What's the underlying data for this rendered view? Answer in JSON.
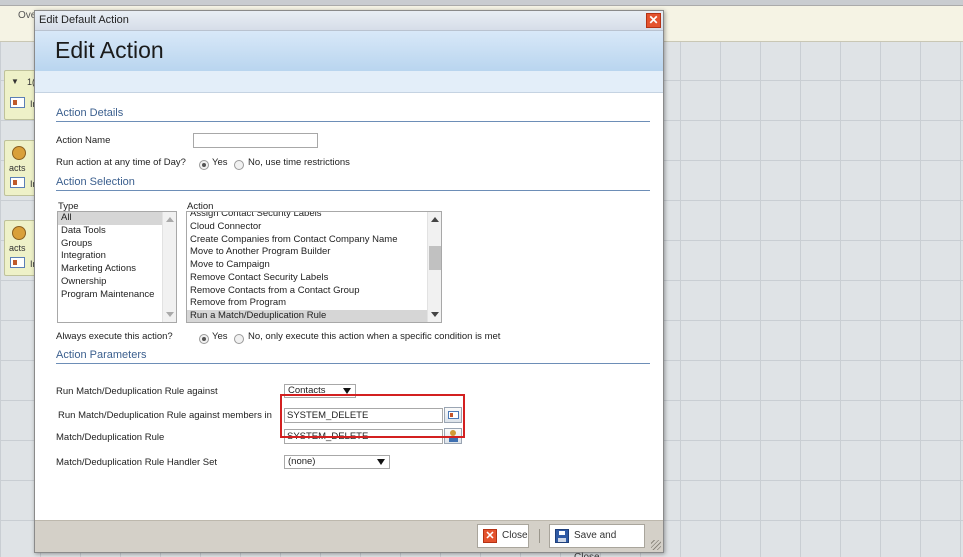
{
  "background": {
    "overview_label": "Ove",
    "node_labels": [
      "1(",
      "Ir",
      "acts",
      "Ir",
      "acts",
      "Ir"
    ]
  },
  "dialog": {
    "window_title": "Edit Default Action",
    "close_glyph": "✕",
    "header_title": "Edit Action"
  },
  "action_details": {
    "heading": "Action Details",
    "name_label": "Action Name",
    "name_value": "",
    "time_label": "Run action at any time of Day?",
    "time_options": [
      {
        "label": "Yes",
        "selected": true
      },
      {
        "label": "No, use time restrictions",
        "selected": false
      }
    ]
  },
  "action_selection": {
    "heading": "Action Selection",
    "type_header": "Type",
    "action_header": "Action",
    "types": [
      "All",
      "Data Tools",
      "Groups",
      "Integration",
      "Marketing Actions",
      "Ownership",
      "Program Maintenance"
    ],
    "selected_type": "All",
    "actions": [
      "Assign Contact Security Labels",
      "Cloud Connector",
      "Create Companies from Contact Company Name",
      "Move to Another Program Builder",
      "Move to Campaign",
      "Remove Contact Security Labels",
      "Remove Contacts from a Contact Group",
      "Remove from Program",
      "Run a Match/Deduplication Rule"
    ],
    "selected_action": "Run a Match/Deduplication Rule",
    "always_label": "Always execute this action?",
    "always_options": [
      {
        "label": "Yes",
        "selected": true
      },
      {
        "label": "No, only execute this action when a specific condition is met",
        "selected": false
      }
    ]
  },
  "action_parameters": {
    "heading": "Action Parameters",
    "against_label": "Run Match/Deduplication Rule against",
    "against_value": "Contacts",
    "members_label": "Run Match/Deduplication Rule against members in",
    "members_value": "SYSTEM_DELETE",
    "rule_label": "Match/Deduplication Rule",
    "rule_value": "SYSTEM_DELETE",
    "handler_label": "Match/Deduplication Rule Handler Set",
    "handler_value": "(none)"
  },
  "footer": {
    "close_label": "Close",
    "save_label": "Save and Close"
  },
  "colors": {
    "highlight": "#d32020",
    "section_heading": "#3b5f8e",
    "close_red": "#e4532e"
  },
  "icons": [
    "close-icon",
    "contact-picker-icon",
    "save-icon",
    "resize-grip-icon"
  ]
}
